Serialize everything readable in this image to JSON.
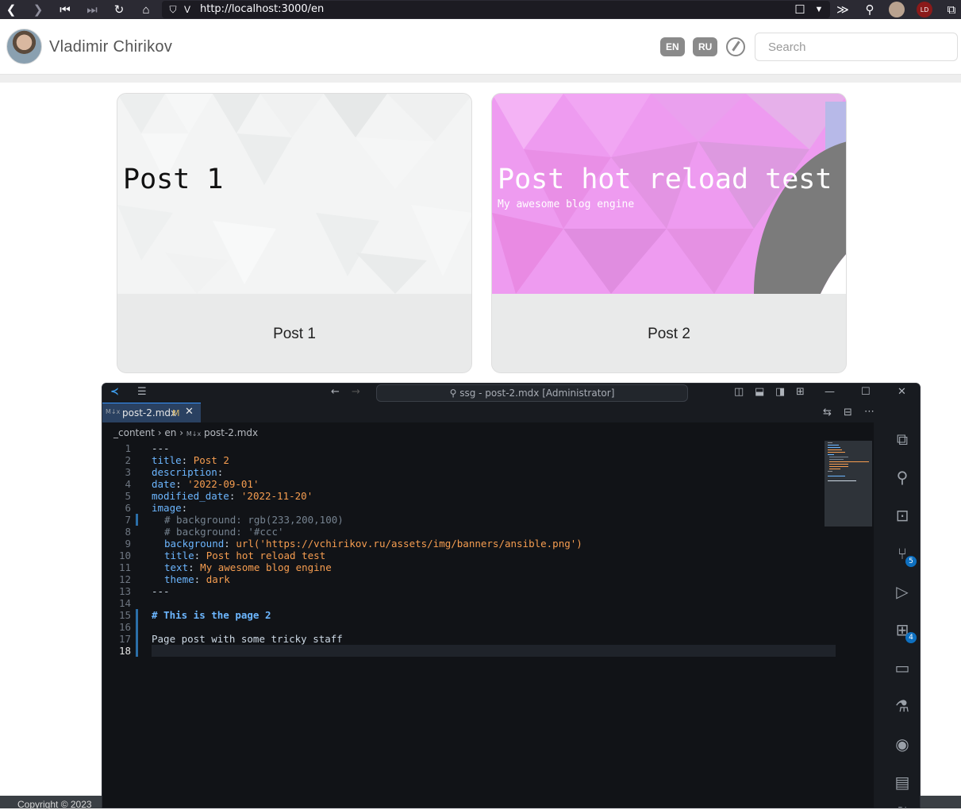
{
  "browser": {
    "url": "http://localhost:3000/en"
  },
  "site": {
    "author_name": "Vladimir Chirikov",
    "langs": [
      "EN",
      "RU"
    ],
    "search_placeholder": "Search",
    "copyright": "Copyright © 2023"
  },
  "cards": [
    {
      "banner_title": "Post 1",
      "banner_text": "",
      "title": "Post 1"
    },
    {
      "banner_title": "Post hot reload test",
      "banner_text": "My awesome blog engine",
      "title": "Post 2"
    }
  ],
  "vscode": {
    "window_title": "ssg - post-2.mdx [Administrator]",
    "tab_label": "post-2.mdx",
    "tab_status": "M",
    "breadcrumb": [
      "_content",
      "en",
      "post-2.mdx"
    ],
    "file_icon_label": "M↓x",
    "badges": {
      "source_control": "5",
      "extensions": "4"
    },
    "bottom_label": "RJ",
    "line_numbers": [
      "1",
      "2",
      "3",
      "4",
      "5",
      "6",
      "7",
      "8",
      "9",
      "10",
      "11",
      "12",
      "13",
      "14",
      "15",
      "16",
      "17",
      "18"
    ],
    "lines": {
      "l1": "---",
      "l2_key": "title",
      "l2_val": "Post 2",
      "l3_key": "description",
      "l4_key": "date",
      "l4_val": "'2022-09-01'",
      "l5_key": "modified_date",
      "l5_val": "'2022-11-20'",
      "l6_key": "image",
      "l7": "# background: rgb(233,200,100)",
      "l8": "# background: '#ccc'",
      "l9_key": "background",
      "l9_val": "url('https://vchirikov.ru/assets/img/banners/ansible.png')",
      "l10_key": "title",
      "l10_val": "Post hot reload test",
      "l11_key": "text",
      "l11_val": "My awesome blog engine",
      "l12_key": "theme",
      "l12_val": "dark",
      "l13": "---",
      "l15": "# This is the page 2",
      "l17": "Page post with some tricky staff"
    }
  },
  "colors": {
    "vscode_bg": "#111317",
    "tab_active": "#2a4161",
    "badge_blue": "#0e70c0",
    "post2_banner": "#ee9bf0"
  }
}
